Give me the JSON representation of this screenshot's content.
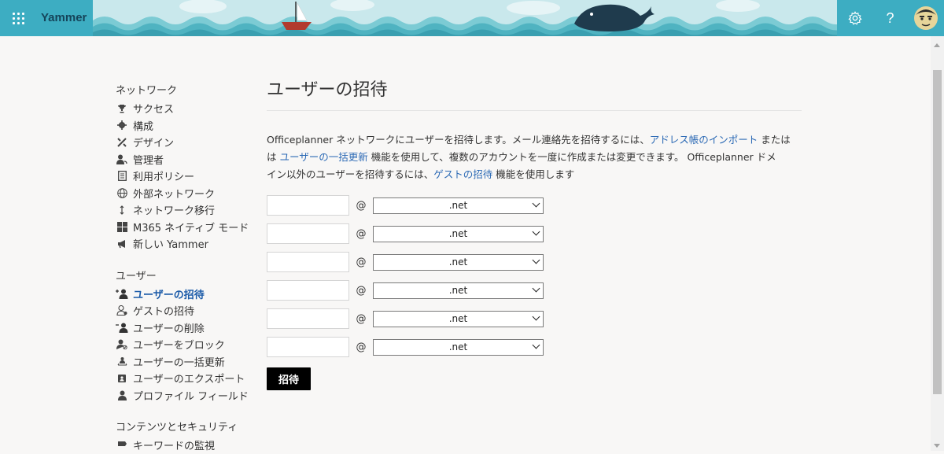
{
  "header": {
    "brand": "Yammer",
    "waffle_icon": "app-launcher-icon",
    "settings_icon": "gear-icon",
    "help_label": "?",
    "avatar_icon": "user-avatar",
    "colors": {
      "bar": "#3dadc2",
      "brand_text": "#15445a"
    }
  },
  "sidebar": {
    "network_heading": "ネットワーク",
    "network_items": [
      {
        "label": "サクセス",
        "icon": "trophy-icon"
      },
      {
        "label": "構成",
        "icon": "gear-icon"
      },
      {
        "label": "デザイン",
        "icon": "design-tools-icon"
      },
      {
        "label": "管理者",
        "icon": "admin-person-icon"
      },
      {
        "label": "利用ポリシー",
        "icon": "document-icon"
      },
      {
        "label": "外部ネットワーク",
        "icon": "globe-icon"
      },
      {
        "label": "ネットワーク移行",
        "icon": "migrate-arrows-icon"
      },
      {
        "label": "M365 ネイティブ モード",
        "icon": "windows-grid-icon"
      },
      {
        "label": "新しい Yammer",
        "icon": "megaphone-icon"
      }
    ],
    "users_heading": "ユーザー",
    "users_items": [
      {
        "label": "ユーザーの招待",
        "icon": "add-person-icon",
        "active": true
      },
      {
        "label": "ゲストの招待",
        "icon": "guest-person-icon"
      },
      {
        "label": "ユーザーの削除",
        "icon": "remove-person-icon"
      },
      {
        "label": "ユーザーをブロック",
        "icon": "block-person-icon"
      },
      {
        "label": "ユーザーの一括更新",
        "icon": "bulk-users-icon"
      },
      {
        "label": "ユーザーのエクスポート",
        "icon": "export-contact-icon"
      },
      {
        "label": "プロファイル フィールド",
        "icon": "person-icon"
      }
    ],
    "content_heading": "コンテンツとセキュリティ",
    "content_items": [
      {
        "label": "キーワードの監視",
        "icon": "flag-icon"
      }
    ]
  },
  "main": {
    "title": "ユーザーの招待",
    "desc_1": "Officeplanner ネットワークにユーザーを招待します。メール連絡先を招待するには、",
    "link_import": "アドレス帳のインポート",
    "desc_2": " または",
    "desc_3": "は ",
    "link_bulk": "ユーザーの一括更新",
    "desc_4": " 機能を使用して、複数のアカウントを一度に作成または変更できます。 Officeplanner ドメ",
    "desc_5": "イン以外のユーザーを招待するには、",
    "link_guest": "ゲストの招待",
    "desc_6": " 機能を使用します",
    "at_symbol": "@",
    "rows": [
      {
        "email": "",
        "domain": ".net"
      },
      {
        "email": "",
        "domain": ".net"
      },
      {
        "email": "",
        "domain": ".net"
      },
      {
        "email": "",
        "domain": ".net"
      },
      {
        "email": "",
        "domain": ".net"
      },
      {
        "email": "",
        "domain": ".net"
      }
    ],
    "invite_button": "招待",
    "link_color": "#2c6ab5"
  }
}
